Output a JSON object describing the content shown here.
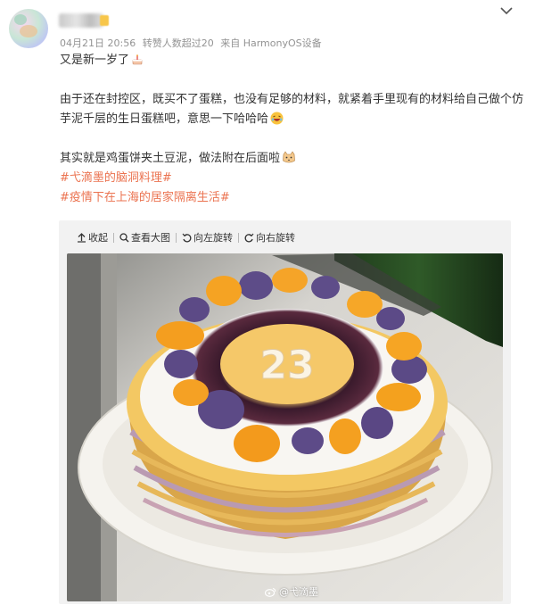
{
  "post": {
    "timestamp": "04月21日 20:56",
    "repost_info": "转赞人数超过20",
    "source": "来自 HarmonyOS设备",
    "line1": "又是新一岁了",
    "line2": "由于还在封控区，既买不了蛋糕，也没有足够的材料，就紧着手里现有的材料给自己做个仿芋泥千层的生日蛋糕吧，意思一下哈哈哈",
    "line3": "其实就是鸡蛋饼夹土豆泥，做法附在后面啦",
    "tags": [
      "#弋滴墨的脑洞料理#",
      "#疫情下在上海的居家隔离生活#"
    ]
  },
  "viewer": {
    "collapse_label": "收起",
    "view_large_label": "查看大图",
    "rotate_left_label": "向左旋转",
    "rotate_right_label": "向右旋转",
    "watermark": "@弋滴墨",
    "cake_number": "23"
  },
  "colors": {
    "link": "#eb7350",
    "meta": "#939393",
    "text": "#333333"
  }
}
